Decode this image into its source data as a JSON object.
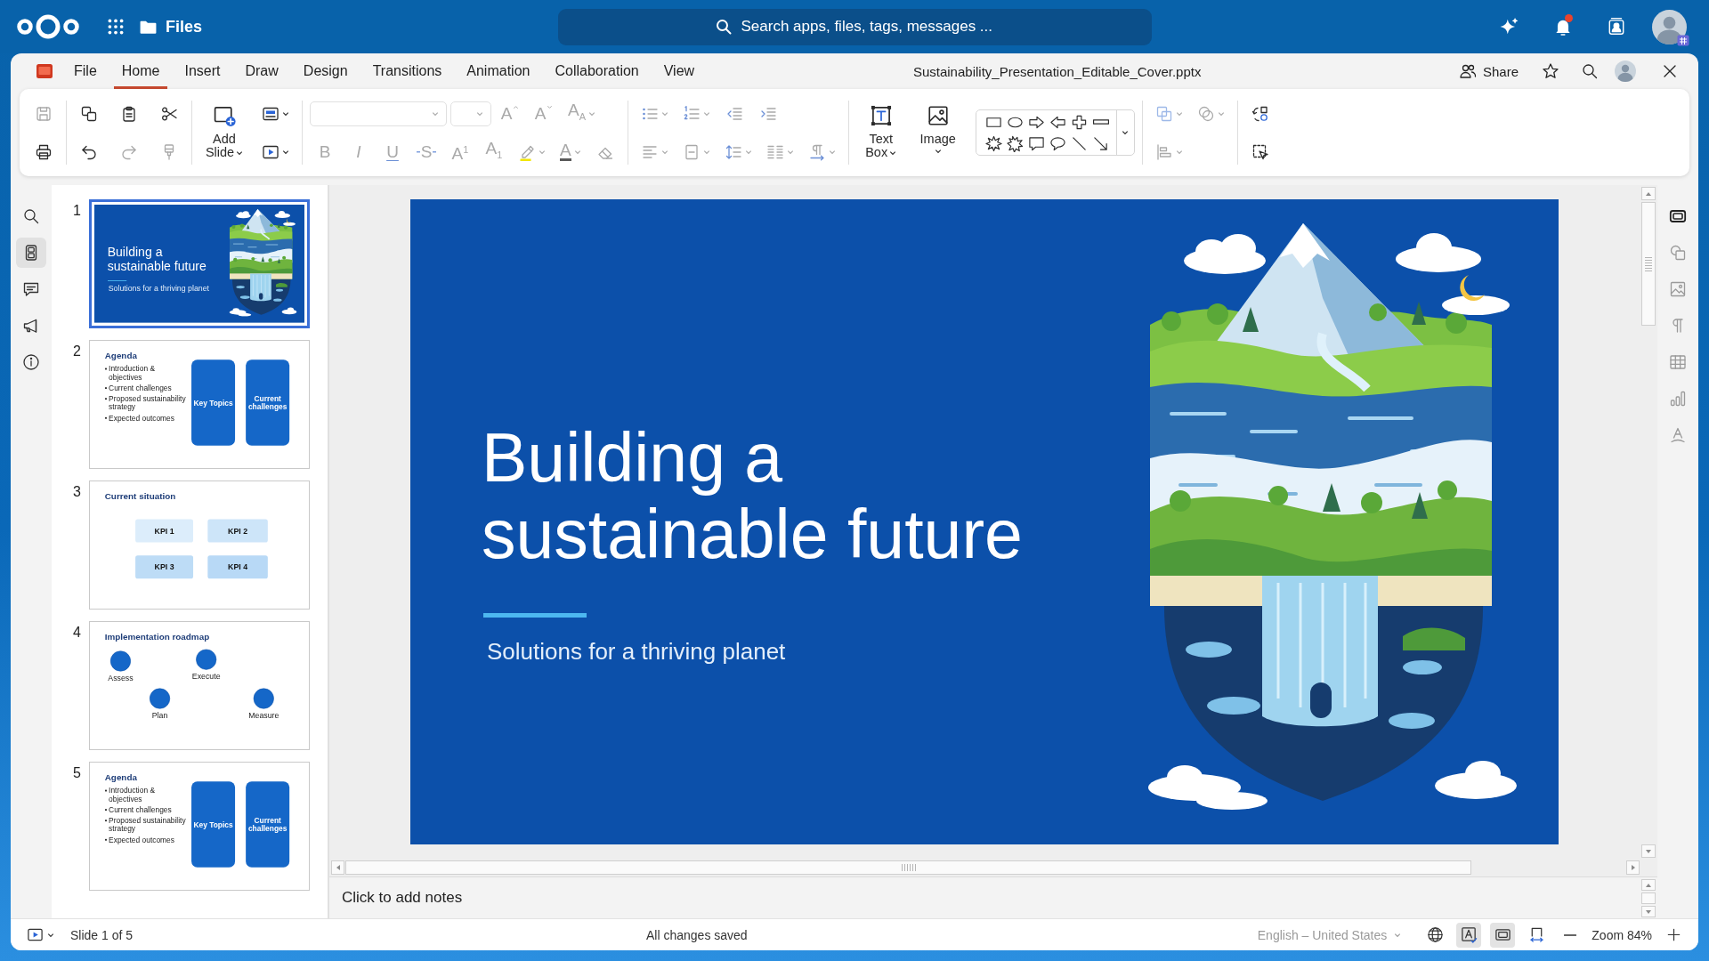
{
  "header": {
    "app_name": "Files",
    "search": {
      "placeholder": "Search apps, files, tags, messages ..."
    },
    "notifications": {
      "unread": true
    }
  },
  "menu": {
    "items": [
      {
        "label": "File",
        "selected": false
      },
      {
        "label": "Home",
        "selected": true
      },
      {
        "label": "Insert",
        "selected": false
      },
      {
        "label": "Draw",
        "selected": false
      },
      {
        "label": "Design",
        "selected": false
      },
      {
        "label": "Transitions",
        "selected": false
      },
      {
        "label": "Animation",
        "selected": false
      },
      {
        "label": "Collaboration",
        "selected": false
      },
      {
        "label": "View",
        "selected": false
      }
    ],
    "document_title": "Sustainability_Presentation_Editable_Cover.pptx",
    "share_label": "Share"
  },
  "toolbar": {
    "groups": [
      {
        "rows": [
          [
            {
              "kind": "icon",
              "disabled": true
            }
          ],
          [
            {
              "kind": "icon",
              "disabled": false
            }
          ]
        ]
      },
      {
        "rows": [
          [
            {
              "kind": "icon",
              "disabled": false
            },
            {
              "kind": "icon",
              "disabled": false
            },
            {
              "kind": "icon",
              "disabled": false
            }
          ],
          [
            {
              "kind": "icon",
              "disabled": false
            },
            {
              "kind": "icon",
              "disabled": true
            },
            {
              "kind": "icon",
              "disabled": true
            }
          ]
        ]
      },
      {
        "large": [
          {
            "label": "Add Slide",
            "disabled": false
          }
        ],
        "rows": [
          [
            {
              "kind": "icon",
              "disabled": false
            }
          ],
          [
            {
              "kind": "icon",
              "disabled": false
            }
          ]
        ]
      },
      {
        "rows": [
          [
            {
              "kind": "field",
              "disabled": true
            },
            {
              "kind": "field",
              "disabled": true
            },
            {
              "kind": "glyph",
              "label": "A",
              "disabled": true
            },
            {
              "kind": "glyph",
              "label": "A",
              "disabled": true
            },
            {
              "kind": "glyph",
              "label": "A$_{A}$",
              "disabled": true
            }
          ],
          [
            {
              "kind": "glyph",
              "label": "B",
              "disabled": true
            },
            {
              "kind": "glyph",
              "label": "I",
              "disabled": true
            },
            {
              "kind": "glyph",
              "label": "U",
              "disabled": true
            },
            {
              "kind": "glyph",
              "label": "S",
              "disabled": true
            },
            {
              "kind": "glyph",
              "label": "A$^{1}$",
              "disabled": true
            },
            {
              "kind": "glyph",
              "label": "A$_{1}$",
              "disabled": true
            },
            {
              "kind": "icon",
              "disabled": true
            },
            {
              "kind": "glyph",
              "label": "A",
              "disabled": true
            },
            {
              "kind": "icon",
              "disabled": true
            }
          ]
        ]
      },
      {
        "rows": [
          [
            {
              "kind": "icon",
              "disabled": true
            },
            {
              "kind": "icon",
              "disabled": true
            },
            {
              "kind": "icon",
              "disabled": true
            },
            {
              "kind": "icon",
              "disabled": true
            }
          ],
          [
            {
              "kind": "icon",
              "disabled": true
            },
            {
              "kind": "icon",
              "disabled": true
            },
            {
              "kind": "icon",
              "disabled": true
            },
            {
              "kind": "icon",
              "disabled": true
            },
            {
              "kind": "icon",
              "disabled": true
            }
          ]
        ]
      },
      {
        "large": [
          {
            "label": "Text Box",
            "disabled": false
          },
          {
            "label": "Image",
            "disabled": false
          }
        ]
      },
      {
        "rows": [
          [
            {
              "kind": "icon",
              "disabled": true
            },
            {
              "kind": "icon",
              "disabled": true
            }
          ],
          [
            {
              "kind": "icon",
              "disabled": true
            }
          ]
        ]
      },
      {
        "rows": [
          [
            {
              "kind": "icon",
              "disabled": false
            }
          ],
          [
            {
              "kind": "icon",
              "disabled": false
            }
          ]
        ]
      }
    ]
  },
  "sidebar": {
    "items": [
      {
        "selected": false
      },
      {
        "selected": true
      },
      {
        "selected": false
      },
      {
        "selected": false
      },
      {
        "selected": false
      }
    ]
  },
  "slides": [
    {
      "number": "1",
      "selected": true,
      "kind": "title",
      "title": "Building a sustainable future",
      "subtitle": "Solutions for a thriving planet"
    },
    {
      "number": "2",
      "selected": false,
      "kind": "agenda",
      "heading": "Agenda",
      "bullets": [
        "Introduction & objectives",
        "Current challenges",
        "Proposed sustainability strategy",
        "Expected outcomes"
      ],
      "cards": [
        "Key Topics",
        "Current challenges"
      ]
    },
    {
      "number": "3",
      "selected": false,
      "kind": "kpi",
      "heading": "Current situation",
      "tiles": [
        {
          "label": "KPI 1",
          "color": "#dcedfb"
        },
        {
          "label": "KPI 2",
          "color": "#cde5f9"
        },
        {
          "label": "KPI 3",
          "color": "#bddcf6"
        },
        {
          "label": "KPI 4",
          "color": "#b8d9f6"
        }
      ]
    },
    {
      "number": "4",
      "selected": false,
      "kind": "roadmap",
      "heading": "Implementation roadmap",
      "steps": [
        "Assess",
        "Plan",
        "Execute",
        "Measure"
      ]
    },
    {
      "number": "5",
      "selected": false,
      "kind": "agenda",
      "heading": "Agenda",
      "bullets": [
        "Introduction & objectives",
        "Current challenges",
        "Proposed sustainability strategy",
        "Expected outcomes"
      ],
      "cards": [
        "Key Topics",
        "Current challenges"
      ]
    }
  ],
  "editor": {
    "slide": {
      "kind": "title",
      "title": "Building a sustainable future",
      "subtitle": "Solutions for a thriving planet"
    },
    "notes": {
      "placeholder": "Click to add notes"
    }
  },
  "deck": {
    "items": [
      {
        "disabled": false
      },
      {
        "disabled": true
      },
      {
        "disabled": true
      },
      {
        "disabled": true
      },
      {
        "disabled": true
      },
      {
        "disabled": true
      },
      {
        "disabled": true
      }
    ]
  },
  "status_bar": {
    "slide_position": "Slide 1 of 5",
    "save_state": "All changes saved",
    "language": "English – United States",
    "spelling_on": true,
    "fit_slide_on": true,
    "fit_width_on": false,
    "zoom": "Zoom 84%"
  }
}
